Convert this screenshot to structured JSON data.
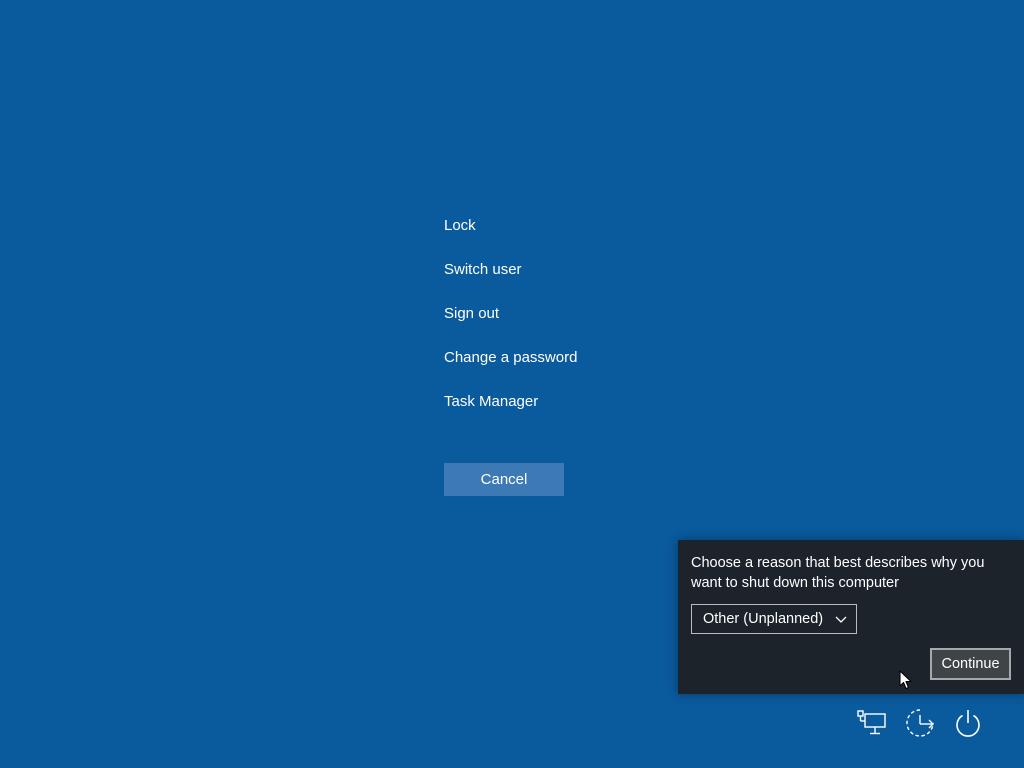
{
  "menu": {
    "items": [
      {
        "label": "Lock",
        "name": "menu-item-lock"
      },
      {
        "label": "Switch user",
        "name": "menu-item-switch-user"
      },
      {
        "label": "Sign out",
        "name": "menu-item-sign-out"
      },
      {
        "label": "Change a password",
        "name": "menu-item-change-password"
      },
      {
        "label": "Task Manager",
        "name": "menu-item-task-manager"
      }
    ],
    "cancel_label": "Cancel"
  },
  "shutdown_panel": {
    "prompt": "Choose a reason that best describes why you want to shut down this computer",
    "reason_selected": "Other (Unplanned)",
    "continue_label": "Continue"
  },
  "tray": {
    "icons": [
      "network-icon",
      "ease-of-access-icon",
      "power-icon"
    ]
  },
  "colors": {
    "background": "#0a5a9e",
    "cancel_button": "#3d7ab5",
    "panel_background": "#1c232b"
  }
}
